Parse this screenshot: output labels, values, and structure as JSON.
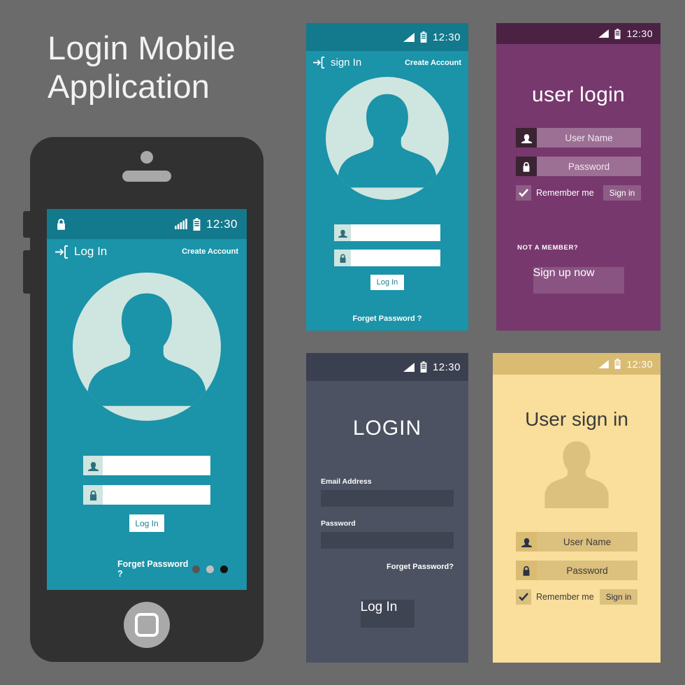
{
  "page": {
    "headline_line1": "Login Mobile",
    "headline_line2": "Application",
    "background_color": "#6b6b6b"
  },
  "colors": {
    "teal": "#1b93a8",
    "teal_dark": "#13798c",
    "mint": "#cfe5e0",
    "purple": "#77386d",
    "purple_dark": "#4b2244",
    "purple_field": "#9c6f95",
    "slate": "#4c5261",
    "slate_dark": "#3b4050",
    "yellow": "#fade9b",
    "yellow_dark": "#d9bb72",
    "device_body": "#313131"
  },
  "status_bar": {
    "time": "12:30",
    "signal_icon": "signal-bars-icon",
    "battery_icon": "battery-icon",
    "lock_icon": "lock-icon"
  },
  "screen1": {
    "name": "phone-mockup-login",
    "appbar": {
      "login_arrow_icon": "login-arrow-icon",
      "title": "Log In",
      "create_account": "Create Account"
    },
    "avatar_icon": "user-avatar-icon",
    "username_field": {
      "icon": "user-icon",
      "value": "",
      "placeholder": ""
    },
    "password_field": {
      "icon": "lock-icon",
      "value": "",
      "placeholder": ""
    },
    "login_button": "Log In",
    "forget_password": "Forget Password ?",
    "page_dots": [
      "#555555",
      "#c0c0c0",
      "#111111"
    ]
  },
  "screen2": {
    "name": "sign-in-teal",
    "appbar": {
      "login_arrow_icon": "login-arrow-icon",
      "title": "sign In",
      "create_account": "Create Account"
    },
    "avatar_icon": "user-avatar-icon",
    "username_field": {
      "icon": "user-icon",
      "value": "",
      "placeholder": ""
    },
    "password_field": {
      "icon": "lock-icon",
      "value": "",
      "placeholder": ""
    },
    "login_button": "Log In",
    "forget_password": "Forget Password ?"
  },
  "screen3": {
    "name": "user-login-purple",
    "title": "user login",
    "username_field": {
      "icon": "user-icon",
      "placeholder": "User Name"
    },
    "password_field": {
      "icon": "lock-icon",
      "placeholder": "Password"
    },
    "remember_me": {
      "label": "Remember me",
      "icon": "check-icon",
      "checked": true
    },
    "sign_in_button": "Sign in",
    "not_a_member": "NOT A MEMBER?",
    "sign_up_button": "Sign up now"
  },
  "screen4": {
    "name": "login-dark",
    "title": "LOGIN",
    "email_label": "Email Address",
    "email_value": "",
    "password_label": "Password",
    "password_value": "",
    "forget_password": "Forget Password?",
    "login_button": "Log In"
  },
  "screen5": {
    "name": "user-sign-in-yellow",
    "title": "User sign in",
    "avatar_icon": "user-avatar-icon",
    "username_field": {
      "icon": "user-icon",
      "placeholder": "User Name"
    },
    "password_field": {
      "icon": "lock-icon",
      "placeholder": "Password"
    },
    "remember_me": {
      "label": "Remember me",
      "icon": "check-icon",
      "checked": true
    },
    "sign_in_button": "Sign in"
  }
}
